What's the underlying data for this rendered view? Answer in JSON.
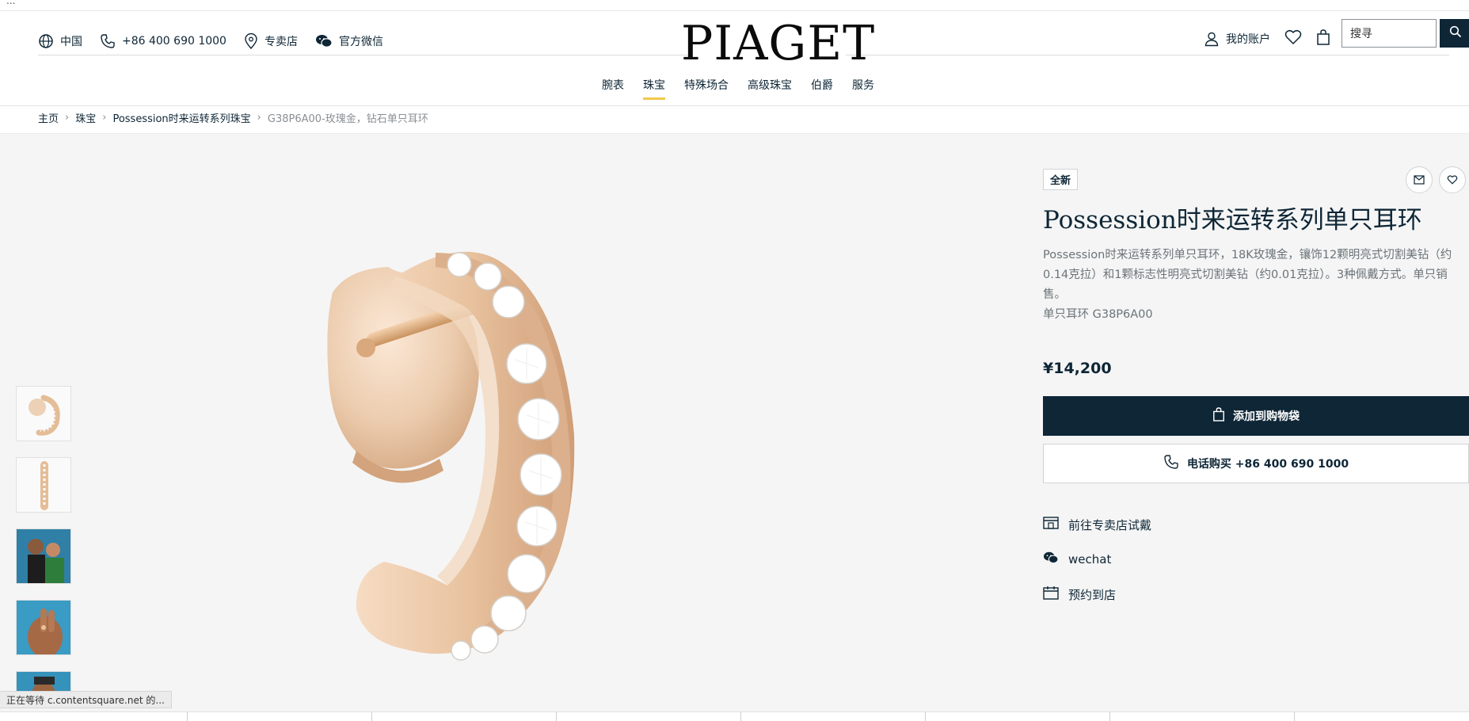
{
  "window_fragment": "...",
  "header": {
    "region": "中国",
    "phone": "+86 400 690 1000",
    "store": "专卖店",
    "wechat": "官方微信",
    "logo": "PIAGET",
    "account": "我的账户",
    "search_placeholder": "搜寻"
  },
  "nav": {
    "items": [
      "腕表",
      "珠宝",
      "特殊场合",
      "高级珠宝",
      "伯爵",
      "服务"
    ],
    "active": "珠宝"
  },
  "breadcrumb": {
    "items": [
      "主页",
      "珠宝",
      "Possession时来运转系列珠宝"
    ],
    "current": "G38P6A00-玫瑰金，钻石单只耳环"
  },
  "product": {
    "badge": "全新",
    "title": "Possession时来运转系列单只耳环",
    "description": "Possession时来运转系列单只耳环，18K玫瑰金，镶饰12颗明亮式切割美钻（约0.14克拉）和1颗标志性明亮式切割美钻（约0.01克拉）。3种佩戴方式。单只销售。",
    "sku_line": "单只耳环 G38P6A00",
    "price": "¥14,200",
    "add_to_bag": "添加到购物袋",
    "call_to_buy": "电话购买 +86 400 690 1000",
    "links": {
      "try_in_store": "前往专卖店试戴",
      "wechat": "wechat",
      "book_appointment": "预约到店"
    }
  },
  "status_bar": {
    "text": "正在等待 c.contentsquare.net 的..."
  },
  "colors": {
    "navy": "#0e2636",
    "accent_underline": "#f2c94c",
    "gold": "#e8c19e",
    "background": "#f5f5f5"
  },
  "icons": [
    "globe-icon",
    "phone-icon",
    "location-pin-icon",
    "wechat-icon",
    "user-icon",
    "heart-icon",
    "bag-icon",
    "search-icon",
    "mail-icon",
    "store-icon",
    "calendar-icon"
  ]
}
